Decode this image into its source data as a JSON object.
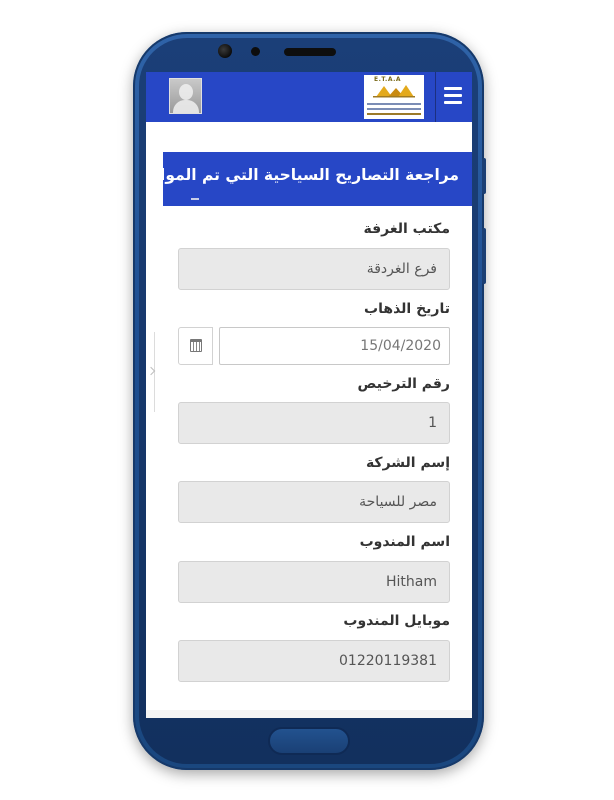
{
  "topbar": {
    "logo_text": "E.T.A.A",
    "logo_sub_en": "Egyptian Travel Agents Association",
    "logo_sub_ar": "غرفة شركات ووكالات السفر والسياحة"
  },
  "page": {
    "title": "مراجعة التصاريح السياحية التي تم الموافقة عليها"
  },
  "form": {
    "office_label": "مكتب الغرفة",
    "office_value": "فرع الغردقة",
    "date_label": "تاريخ الذهاب",
    "date_value": "15/04/2020",
    "license_label": "رقم الترخيص",
    "license_value": "1",
    "company_label": "إسم الشركة",
    "company_value": "مصر للسياحة",
    "rep_label": "اسم المندوب",
    "rep_value": "Hitham",
    "mobile_label": "موبايل المندوب",
    "mobile_value": "01220119381"
  },
  "colors": {
    "primary": "#2747c6",
    "phone_body": "#1e4f92",
    "field_bg": "#e9e9e9"
  },
  "icons": [
    "user-avatar-icon",
    "hamburger-menu-icon",
    "calendar-icon",
    "chevron-right-icon"
  ]
}
